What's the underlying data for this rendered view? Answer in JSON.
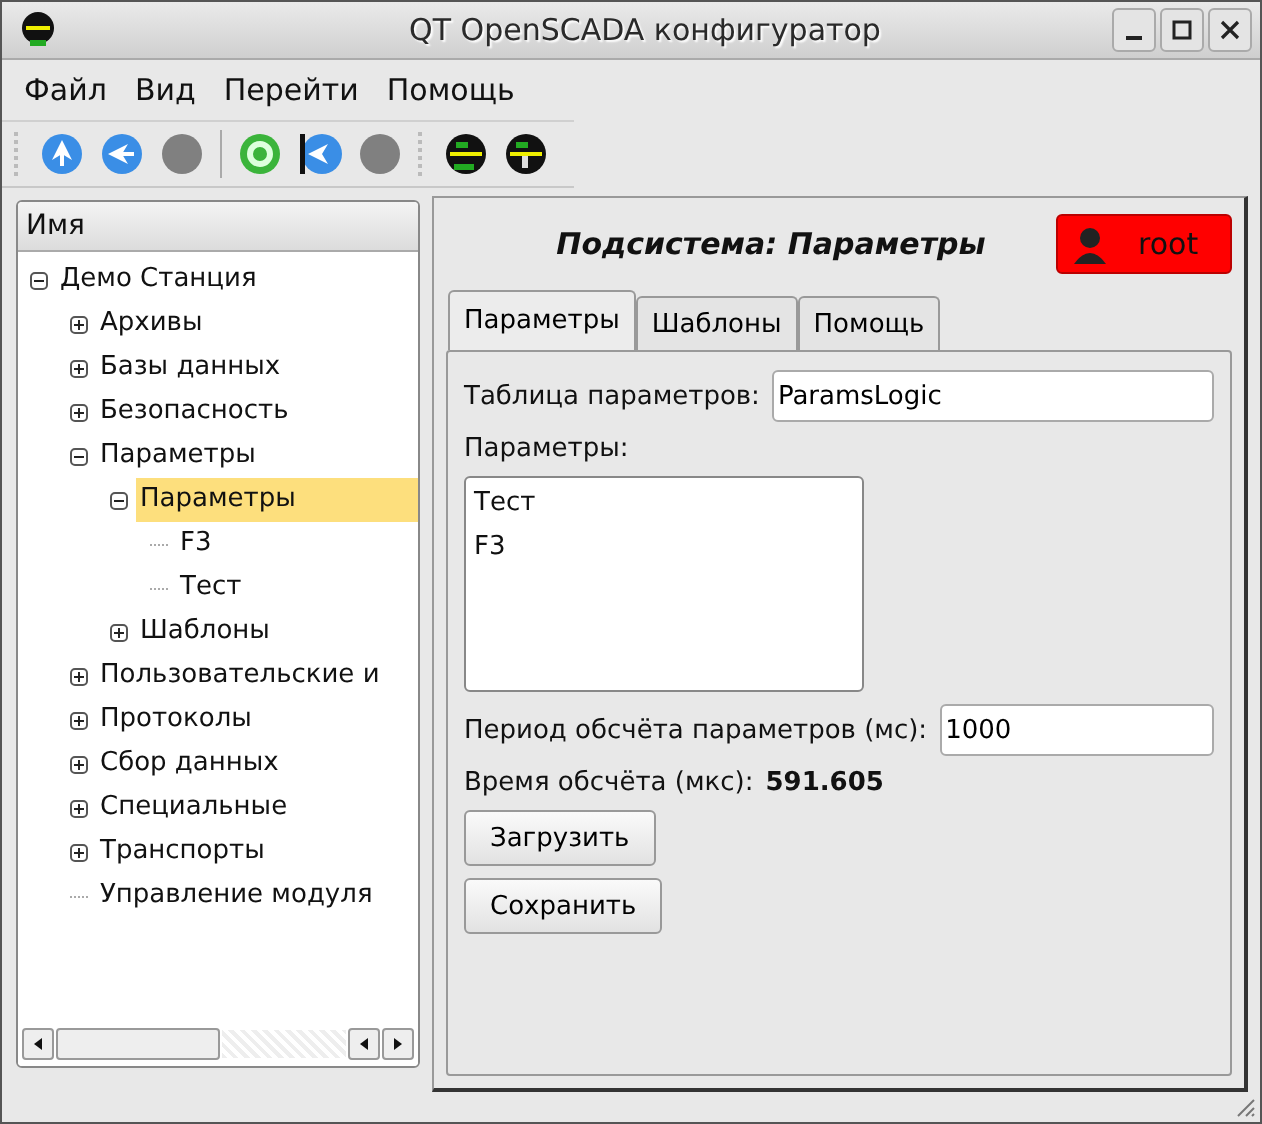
{
  "window": {
    "title": "QT OpenSCADA конфигуратор"
  },
  "menu": [
    "Файл",
    "Вид",
    "Перейти",
    "Помощь"
  ],
  "tree": {
    "header": "Имя",
    "items": [
      {
        "label": "Демо Станция",
        "expanded": true,
        "selected": false,
        "children": [
          {
            "label": "Архивы",
            "expanded": false,
            "selected": false
          },
          {
            "label": "Базы данных",
            "expanded": false,
            "selected": false
          },
          {
            "label": "Безопасность",
            "expanded": false,
            "selected": false
          },
          {
            "label": "Параметры",
            "expanded": true,
            "selected": false,
            "children": [
              {
                "label": "Параметры",
                "expanded": true,
                "selected": true,
                "children": [
                  {
                    "label": "F3",
                    "selected": false
                  },
                  {
                    "label": "Тест",
                    "selected": false
                  }
                ]
              },
              {
                "label": "Шаблоны",
                "expanded": false,
                "selected": false
              }
            ]
          },
          {
            "label": "Пользовательские и",
            "expanded": false,
            "selected": false
          },
          {
            "label": "Протоколы",
            "expanded": false,
            "selected": false
          },
          {
            "label": "Сбор данных",
            "expanded": false,
            "selected": false
          },
          {
            "label": "Специальные",
            "expanded": false,
            "selected": false
          },
          {
            "label": "Транспорты",
            "expanded": false,
            "selected": false
          },
          {
            "label": "Управление модуля",
            "selected": false
          }
        ]
      }
    ]
  },
  "page": {
    "title": "Подсистема: Параметры",
    "user": "root",
    "tabs": [
      {
        "label": "Параметры",
        "selected": true
      },
      {
        "label": "Шаблоны",
        "selected": false
      },
      {
        "label": "Помощь",
        "selected": false
      }
    ],
    "table_label": "Таблица параметров:",
    "table_value": "ParamsLogic",
    "params_label": "Параметры:",
    "params": [
      "Тест",
      "F3"
    ],
    "period_label": "Период обсчёта параметров (мс):",
    "period_value": "1000",
    "time_label": "Время обсчёта (мкс):",
    "time_value": "591.605",
    "buttons": [
      "Загрузить",
      "Сохранить"
    ]
  }
}
